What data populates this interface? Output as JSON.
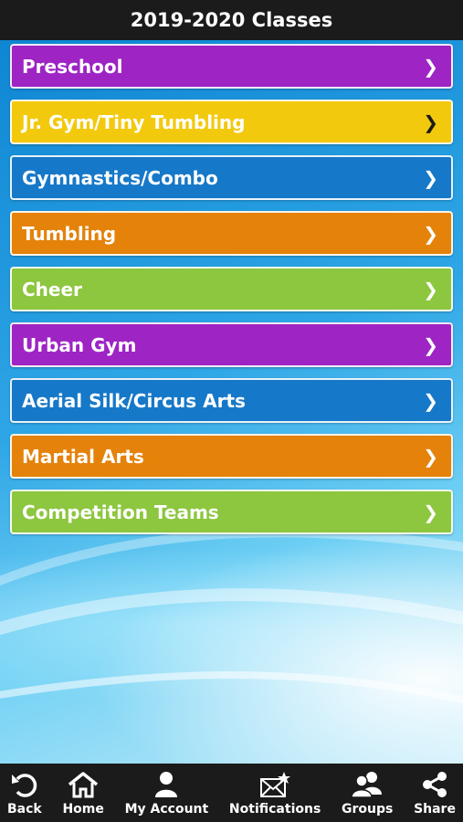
{
  "header": {
    "title": "2019-2020 Classes"
  },
  "classes": [
    {
      "label": "Preschool",
      "color": "#9e24c4"
    },
    {
      "label": "Jr. Gym/Tiny Tumbling",
      "color": "#f3c90e"
    },
    {
      "label": "Gymnastics/Combo",
      "color": "#1678c8"
    },
    {
      "label": "Tumbling",
      "color": "#e4820a"
    },
    {
      "label": "Cheer",
      "color": "#8dc63f"
    },
    {
      "label": "Urban Gym",
      "color": "#9e24c4"
    },
    {
      "label": "Aerial Silk/Circus Arts",
      "color": "#1678c8"
    },
    {
      "label": "Martial Arts",
      "color": "#e4820a"
    },
    {
      "label": "Competition Teams",
      "color": "#8dc63f"
    }
  ],
  "chevron": "❯",
  "tabs": [
    {
      "label": "Back",
      "icon": "back-icon"
    },
    {
      "label": "Home",
      "icon": "home-icon"
    },
    {
      "label": "My Account",
      "icon": "user-icon"
    },
    {
      "label": "Notifications",
      "icon": "envelope-star-icon"
    },
    {
      "label": "Groups",
      "icon": "groups-icon"
    },
    {
      "label": "Share",
      "icon": "share-icon"
    }
  ]
}
